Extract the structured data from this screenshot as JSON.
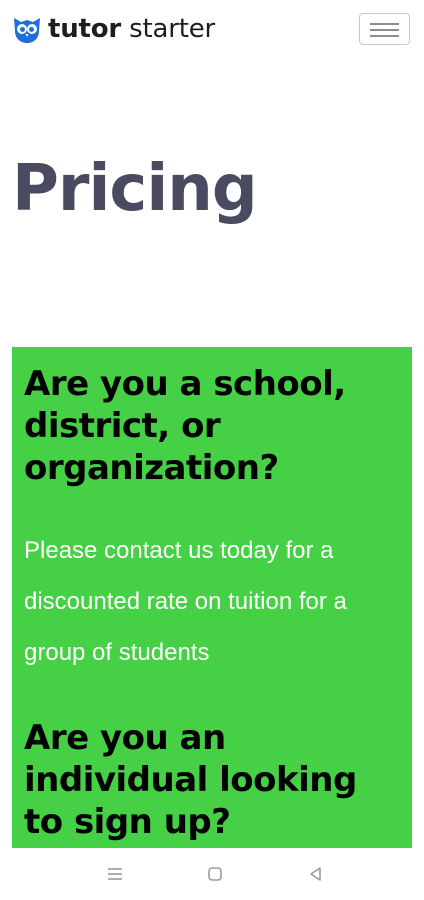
{
  "header": {
    "brand_bold": "tutor",
    "brand_light": "starter",
    "logo_icon": "owl-logo-icon",
    "menu_icon": "hamburger-menu-icon"
  },
  "page": {
    "title": "Pricing"
  },
  "card": {
    "background": "#46d046",
    "heading_org": "Are you a school, district, or organization?",
    "text_org": "Please contact us today for a discounted rate on tuition for a group of students",
    "heading_individual": "Are you an individual looking to sign up?"
  },
  "system_nav": {
    "recents_icon": "recents-icon",
    "home_icon": "home-icon",
    "back_icon": "back-icon"
  }
}
